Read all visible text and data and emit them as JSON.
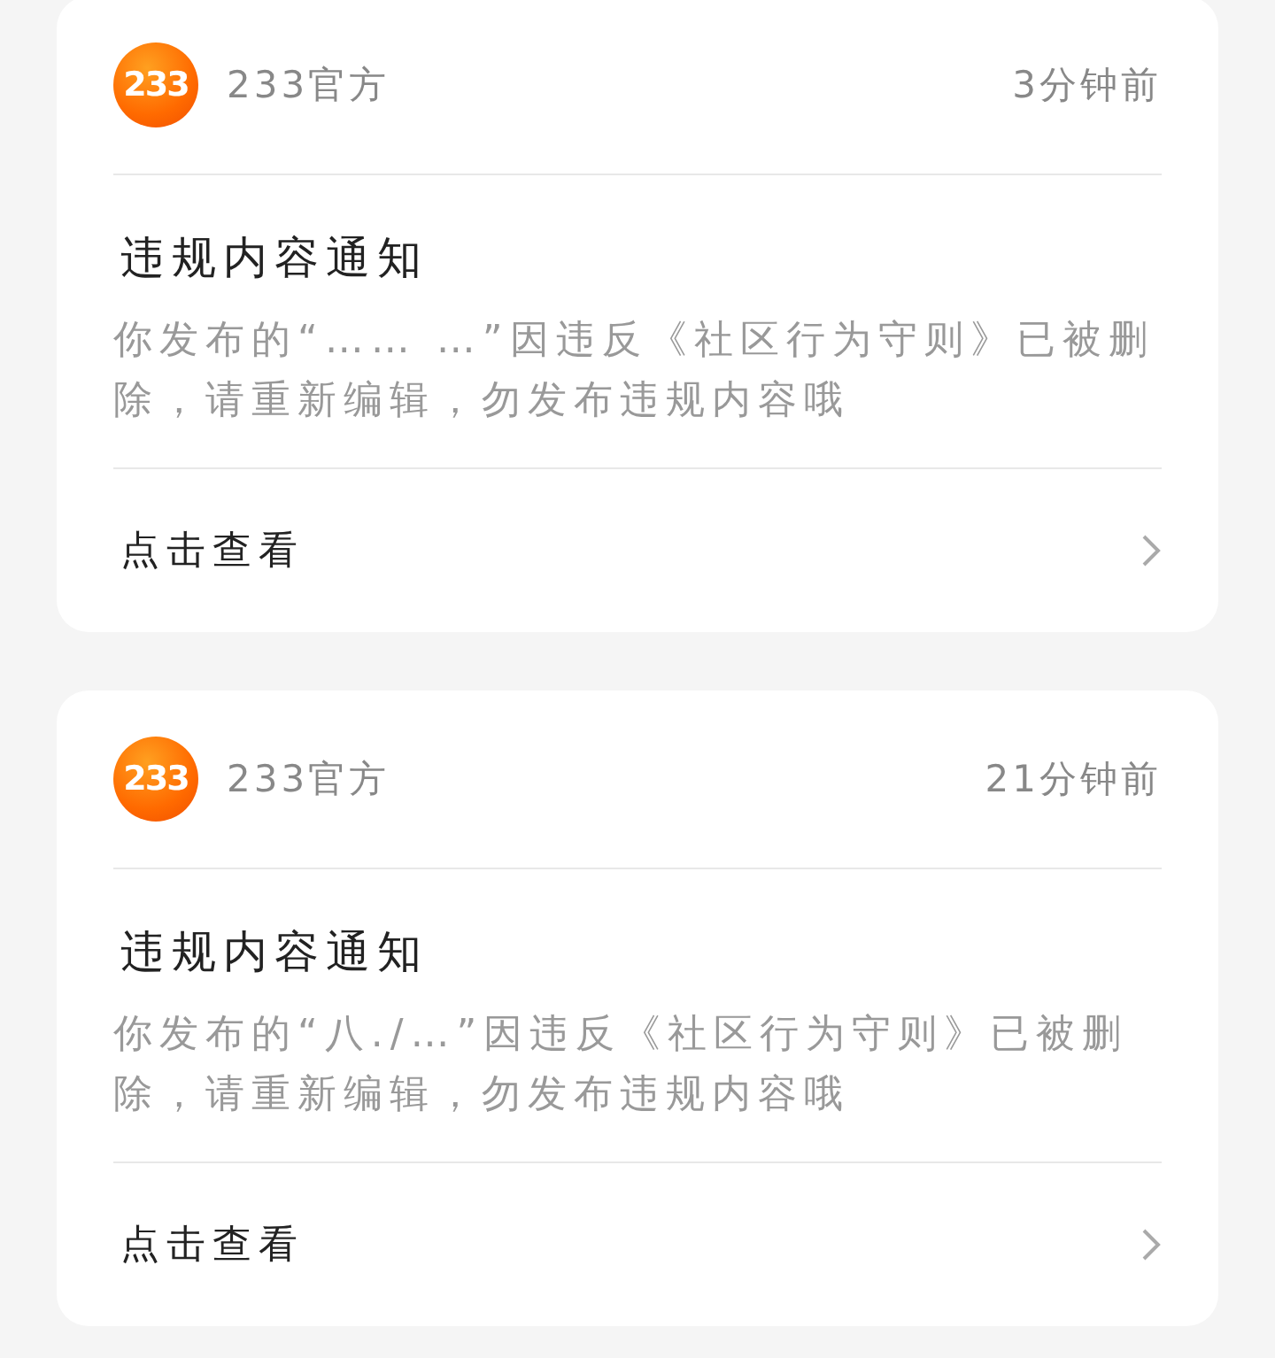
{
  "notifications": [
    {
      "logo_text": "233",
      "sender": "233官方",
      "time": "3分钟前",
      "title": "违规内容通知",
      "body": "你发布的“…… …”因违反《社区行为守则》已被删除，请重新编辑，勿发布违规内容哦",
      "action": "点击查看"
    },
    {
      "logo_text": "233",
      "sender": "233官方",
      "time": "21分钟前",
      "title": "违规内容通知",
      "body": "你发布的“八./…”因违反《社区行为守则》已被删除，请重新编辑，勿发布违规内容哦",
      "action": "点击查看"
    }
  ]
}
